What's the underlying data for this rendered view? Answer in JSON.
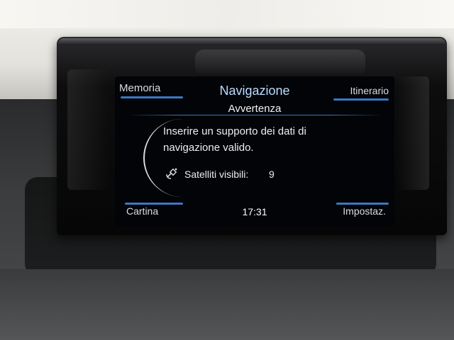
{
  "header": {
    "title": "Navigazione",
    "left_tab": "Memoria",
    "right_tab": "Itinerario"
  },
  "dialog": {
    "title": "Avvertenza",
    "message_line1": "Inserire un supporto dei dati di",
    "message_line2": "navigazione valido.",
    "satellites_label": "Satelliti visibili:",
    "satellites_count": "9",
    "icon": "satellite-icon"
  },
  "footer": {
    "left": "Cartina",
    "clock": "17:31",
    "right": "Impostaz."
  },
  "colors": {
    "screen_background": "#020407",
    "accent_blue": "#3b78c6",
    "title_blue": "#b9dcff",
    "text": "#d9dde2"
  }
}
